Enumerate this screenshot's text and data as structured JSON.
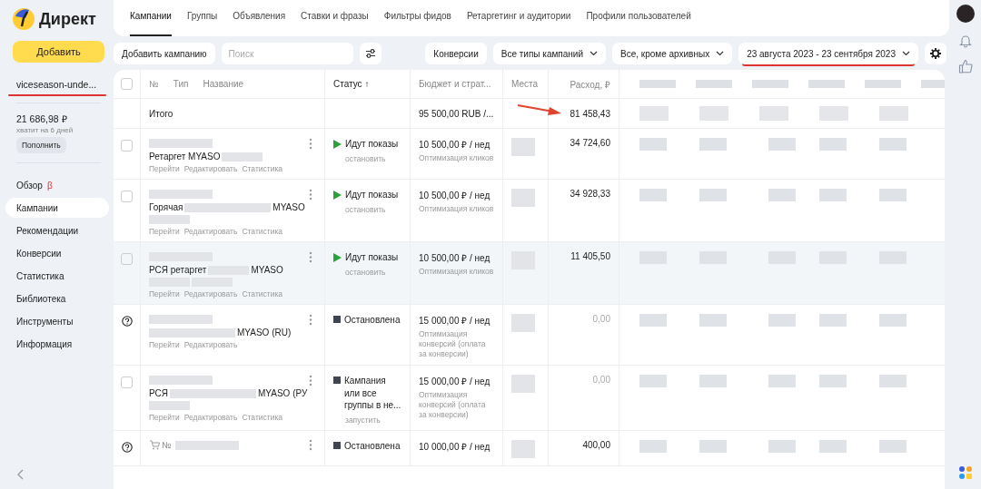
{
  "logo": {
    "text": "Директ"
  },
  "add_button": "Добавить",
  "account": {
    "name": "viceseason-unde...",
    "underlined": true,
    "balance": "21 686,98 ₽",
    "forecast": "хватит на 6 дней",
    "topup": "Пополнить"
  },
  "nav": [
    {
      "label": "Обзор",
      "badge": "β",
      "selected": false
    },
    {
      "label": "Кампании",
      "selected": true
    },
    {
      "label": "Рекомендации",
      "selected": false
    },
    {
      "label": "Конверсии",
      "selected": false
    },
    {
      "label": "Статистика",
      "selected": false
    },
    {
      "label": "Библиотека",
      "selected": false
    },
    {
      "label": "Инструменты",
      "selected": false
    },
    {
      "label": "Информация",
      "selected": false
    }
  ],
  "tabs": [
    {
      "label": "Кампании",
      "selected": true
    },
    {
      "label": "Группы",
      "selected": false
    },
    {
      "label": "Объявления",
      "selected": false
    },
    {
      "label": "Ставки и фразы",
      "selected": false
    },
    {
      "label": "Фильтры фидов",
      "selected": false
    },
    {
      "label": "Ретаргетинг и аудитории",
      "selected": false
    },
    {
      "label": "Профили пользователей",
      "selected": false
    }
  ],
  "toolbar": {
    "add_campaign": "Добавить кампанию",
    "search": {
      "placeholder": "Поиск"
    },
    "conversions": "Конверсии",
    "dropdowns": [
      {
        "label": "Все типы кампаний",
        "underlined": false
      },
      {
        "label": "Все, кроме архивных",
        "underlined": false
      },
      {
        "label": "23 августа 2023 - 23 сентября 2023",
        "underlined": true
      }
    ]
  },
  "table": {
    "select_all": {
      "checked": false
    },
    "columns": {
      "number": "№",
      "type": "Тип",
      "name": "Название",
      "status": "Статус ↑",
      "budget": "Бюджет и страт...",
      "places": "Места",
      "spend": "Расход, ₽"
    },
    "total": {
      "label": "Итого",
      "budget": "95 500,00 RUB /...",
      "spend": "81 458,43",
      "arrow": true
    },
    "rows": [
      {
        "kind": "checkbox",
        "checked": false,
        "cart": false,
        "highlighted": false,
        "name": [
          {
            "kind": "text",
            "text": "Ретаргет MYASO"
          },
          {
            "kind": "redacted"
          }
        ],
        "actions": [
          "Перейти",
          "Редактировать",
          "Статистика"
        ],
        "status": {
          "kind": "running",
          "text": "Идут показы",
          "action": "остановить"
        },
        "budget": "10 500,00 ₽ / нед",
        "strategy": "Оптимизация кликов",
        "spend": "34 724,60",
        "muted": false
      },
      {
        "kind": "checkbox",
        "checked": false,
        "cart": false,
        "highlighted": false,
        "name": [
          {
            "kind": "text",
            "text": "Горячая"
          },
          {
            "kind": "redacted_wide"
          },
          {
            "kind": "text",
            "text": "MYASO"
          },
          {
            "kind": "redacted"
          }
        ],
        "actions": [
          "Перейти",
          "Редактировать",
          "Статистика"
        ],
        "status": {
          "kind": "running",
          "text": "Идут показы",
          "action": "остановить"
        },
        "budget": "10 500,00 ₽ / нед",
        "strategy": "Оптимизация кликов",
        "spend": "34 928,33",
        "muted": false
      },
      {
        "kind": "checkbox",
        "checked": false,
        "cart": false,
        "highlighted": true,
        "name": [
          {
            "kind": "text",
            "text": "РСЯ ретаргет"
          },
          {
            "kind": "redacted"
          },
          {
            "kind": "text",
            "text": "MYASO"
          },
          {
            "kind": "redacted"
          },
          {
            "kind": "redacted"
          }
        ],
        "actions": [
          "Перейти",
          "Редактировать",
          "Статистика"
        ],
        "status": {
          "kind": "running",
          "text": "Идут показы",
          "action": "остановить"
        },
        "budget": "10 500,00 ₽ / нед",
        "strategy": "Оптимизация кликов",
        "spend": "11 405,50",
        "muted": false
      },
      {
        "kind": "help",
        "cart": false,
        "highlighted": false,
        "name": [
          {
            "kind": "redacted_wide"
          },
          {
            "kind": "text",
            "text": "MYASO (RU)"
          }
        ],
        "actions": [
          "Перейти",
          "Редактировать"
        ],
        "status": {
          "kind": "stopped",
          "text": "Остановлена"
        },
        "budget": "15 000,00 ₽ / нед",
        "strategy": "Оптимизация конверсий (оплата за конверсии)",
        "spend": "0,00",
        "muted": true
      },
      {
        "kind": "checkbox",
        "checked": false,
        "cart": false,
        "highlighted": false,
        "name": [
          {
            "kind": "text",
            "text": "РСЯ"
          },
          {
            "kind": "redacted_wide"
          },
          {
            "kind": "text",
            "text": "MYASO (РУ"
          },
          {
            "kind": "redacted"
          }
        ],
        "actions": [
          "Перейти",
          "Редактировать",
          "Статистика"
        ],
        "status": {
          "kind": "stopped",
          "text": "Кампания или все группы в не...",
          "action": "запустить"
        },
        "budget": "15 000,00 ₽ / нед",
        "strategy": "Оптимизация конверсий (оплата за конверсии)",
        "spend": "0,00",
        "muted": true
      },
      {
        "kind": "help",
        "cart": true,
        "number": "№",
        "highlighted": false,
        "name": [],
        "actions": [],
        "status": {
          "kind": "stopped",
          "text": "Остановлена"
        },
        "budget": "10 000,00 ₽ / нед",
        "spend": "400,00",
        "muted": false
      }
    ]
  }
}
